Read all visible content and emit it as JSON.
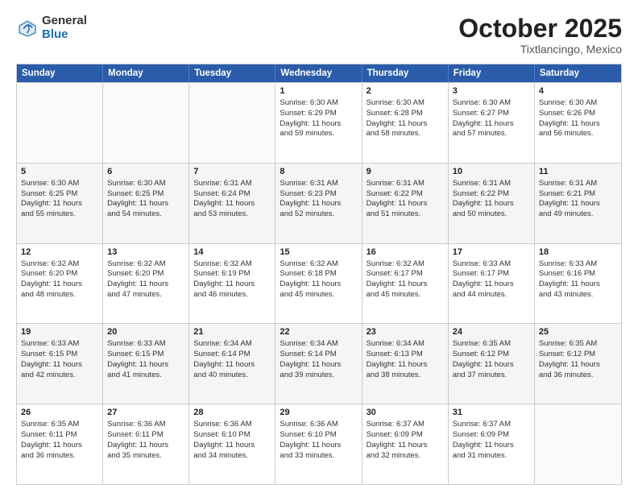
{
  "logo": {
    "general": "General",
    "blue": "Blue"
  },
  "title": "October 2025",
  "location": "Tixtlancingo, Mexico",
  "weekdays": [
    "Sunday",
    "Monday",
    "Tuesday",
    "Wednesday",
    "Thursday",
    "Friday",
    "Saturday"
  ],
  "rows": [
    [
      {
        "day": "",
        "info": ""
      },
      {
        "day": "",
        "info": ""
      },
      {
        "day": "",
        "info": ""
      },
      {
        "day": "1",
        "info": "Sunrise: 6:30 AM\nSunset: 6:29 PM\nDaylight: 11 hours\nand 59 minutes."
      },
      {
        "day": "2",
        "info": "Sunrise: 6:30 AM\nSunset: 6:28 PM\nDaylight: 11 hours\nand 58 minutes."
      },
      {
        "day": "3",
        "info": "Sunrise: 6:30 AM\nSunset: 6:27 PM\nDaylight: 11 hours\nand 57 minutes."
      },
      {
        "day": "4",
        "info": "Sunrise: 6:30 AM\nSunset: 6:26 PM\nDaylight: 11 hours\nand 56 minutes."
      }
    ],
    [
      {
        "day": "5",
        "info": "Sunrise: 6:30 AM\nSunset: 6:25 PM\nDaylight: 11 hours\nand 55 minutes."
      },
      {
        "day": "6",
        "info": "Sunrise: 6:30 AM\nSunset: 6:25 PM\nDaylight: 11 hours\nand 54 minutes."
      },
      {
        "day": "7",
        "info": "Sunrise: 6:31 AM\nSunset: 6:24 PM\nDaylight: 11 hours\nand 53 minutes."
      },
      {
        "day": "8",
        "info": "Sunrise: 6:31 AM\nSunset: 6:23 PM\nDaylight: 11 hours\nand 52 minutes."
      },
      {
        "day": "9",
        "info": "Sunrise: 6:31 AM\nSunset: 6:22 PM\nDaylight: 11 hours\nand 51 minutes."
      },
      {
        "day": "10",
        "info": "Sunrise: 6:31 AM\nSunset: 6:22 PM\nDaylight: 11 hours\nand 50 minutes."
      },
      {
        "day": "11",
        "info": "Sunrise: 6:31 AM\nSunset: 6:21 PM\nDaylight: 11 hours\nand 49 minutes."
      }
    ],
    [
      {
        "day": "12",
        "info": "Sunrise: 6:32 AM\nSunset: 6:20 PM\nDaylight: 11 hours\nand 48 minutes."
      },
      {
        "day": "13",
        "info": "Sunrise: 6:32 AM\nSunset: 6:20 PM\nDaylight: 11 hours\nand 47 minutes."
      },
      {
        "day": "14",
        "info": "Sunrise: 6:32 AM\nSunset: 6:19 PM\nDaylight: 11 hours\nand 46 minutes."
      },
      {
        "day": "15",
        "info": "Sunrise: 6:32 AM\nSunset: 6:18 PM\nDaylight: 11 hours\nand 45 minutes."
      },
      {
        "day": "16",
        "info": "Sunrise: 6:32 AM\nSunset: 6:17 PM\nDaylight: 11 hours\nand 45 minutes."
      },
      {
        "day": "17",
        "info": "Sunrise: 6:33 AM\nSunset: 6:17 PM\nDaylight: 11 hours\nand 44 minutes."
      },
      {
        "day": "18",
        "info": "Sunrise: 6:33 AM\nSunset: 6:16 PM\nDaylight: 11 hours\nand 43 minutes."
      }
    ],
    [
      {
        "day": "19",
        "info": "Sunrise: 6:33 AM\nSunset: 6:15 PM\nDaylight: 11 hours\nand 42 minutes."
      },
      {
        "day": "20",
        "info": "Sunrise: 6:33 AM\nSunset: 6:15 PM\nDaylight: 11 hours\nand 41 minutes."
      },
      {
        "day": "21",
        "info": "Sunrise: 6:34 AM\nSunset: 6:14 PM\nDaylight: 11 hours\nand 40 minutes."
      },
      {
        "day": "22",
        "info": "Sunrise: 6:34 AM\nSunset: 6:14 PM\nDaylight: 11 hours\nand 39 minutes."
      },
      {
        "day": "23",
        "info": "Sunrise: 6:34 AM\nSunset: 6:13 PM\nDaylight: 11 hours\nand 38 minutes."
      },
      {
        "day": "24",
        "info": "Sunrise: 6:35 AM\nSunset: 6:12 PM\nDaylight: 11 hours\nand 37 minutes."
      },
      {
        "day": "25",
        "info": "Sunrise: 6:35 AM\nSunset: 6:12 PM\nDaylight: 11 hours\nand 36 minutes."
      }
    ],
    [
      {
        "day": "26",
        "info": "Sunrise: 6:35 AM\nSunset: 6:11 PM\nDaylight: 11 hours\nand 36 minutes."
      },
      {
        "day": "27",
        "info": "Sunrise: 6:36 AM\nSunset: 6:11 PM\nDaylight: 11 hours\nand 35 minutes."
      },
      {
        "day": "28",
        "info": "Sunrise: 6:36 AM\nSunset: 6:10 PM\nDaylight: 11 hours\nand 34 minutes."
      },
      {
        "day": "29",
        "info": "Sunrise: 6:36 AM\nSunset: 6:10 PM\nDaylight: 11 hours\nand 33 minutes."
      },
      {
        "day": "30",
        "info": "Sunrise: 6:37 AM\nSunset: 6:09 PM\nDaylight: 11 hours\nand 32 minutes."
      },
      {
        "day": "31",
        "info": "Sunrise: 6:37 AM\nSunset: 6:09 PM\nDaylight: 11 hours\nand 31 minutes."
      },
      {
        "day": "",
        "info": ""
      }
    ]
  ]
}
